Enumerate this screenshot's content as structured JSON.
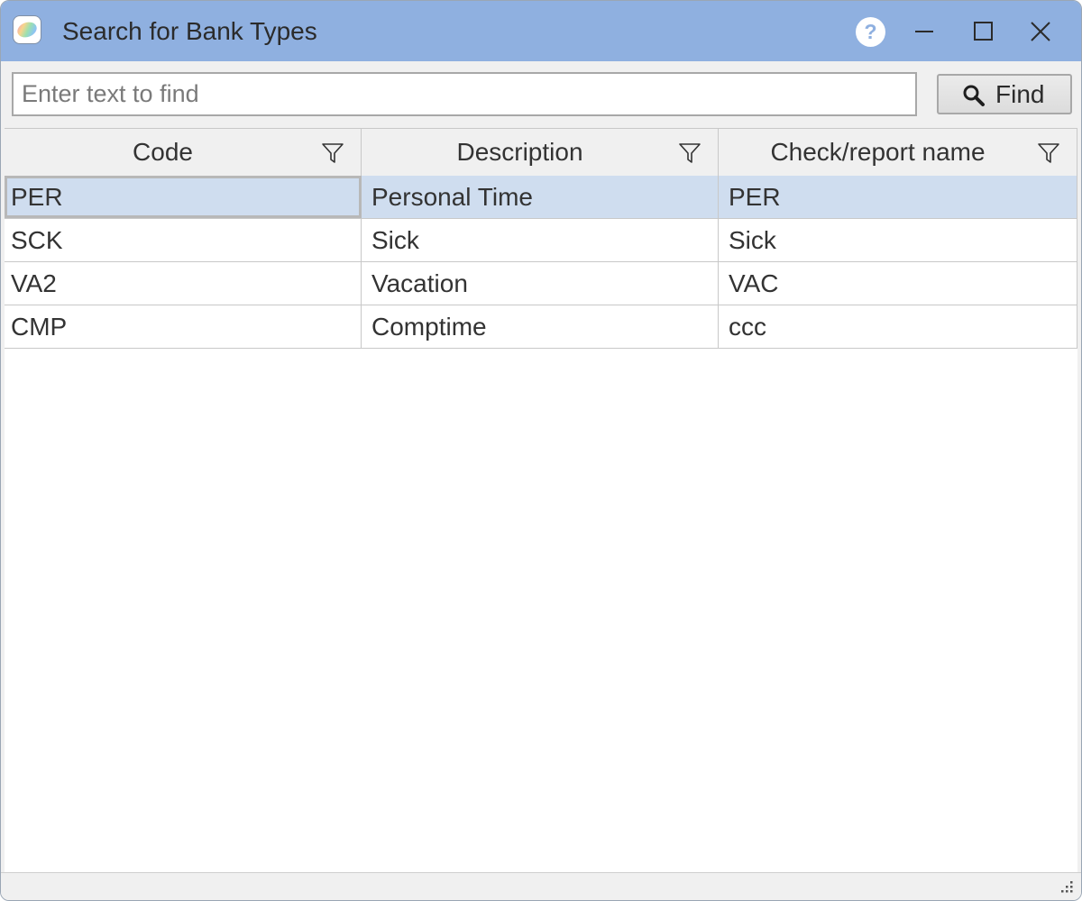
{
  "window": {
    "title": "Search for Bank Types",
    "icons": {
      "app": "app-logo-icon",
      "help": "help-icon",
      "minimize": "minimize-icon",
      "maximize": "maximize-icon",
      "close": "close-icon"
    },
    "help_glyph": "?"
  },
  "search": {
    "placeholder": "Enter text to find",
    "value": "",
    "find_label": "Find",
    "find_icon": "search-icon"
  },
  "grid": {
    "columns": [
      {
        "label": "Code",
        "filter_icon": "filter-icon"
      },
      {
        "label": "Description",
        "filter_icon": "filter-icon"
      },
      {
        "label": "Check/report name",
        "filter_icon": "filter-icon"
      }
    ],
    "rows": [
      {
        "code": "PER",
        "description": "Personal Time",
        "check_name": "PER",
        "selected": true
      },
      {
        "code": "SCK",
        "description": "Sick",
        "check_name": "Sick",
        "selected": false
      },
      {
        "code": "VA2",
        "description": "Vacation",
        "check_name": "VAC",
        "selected": false
      },
      {
        "code": "CMP",
        "description": "Comptime",
        "check_name": "ccc",
        "selected": false
      }
    ]
  },
  "colors": {
    "titlebar": "#8fb0e0",
    "selected_row": "#cfddef"
  }
}
